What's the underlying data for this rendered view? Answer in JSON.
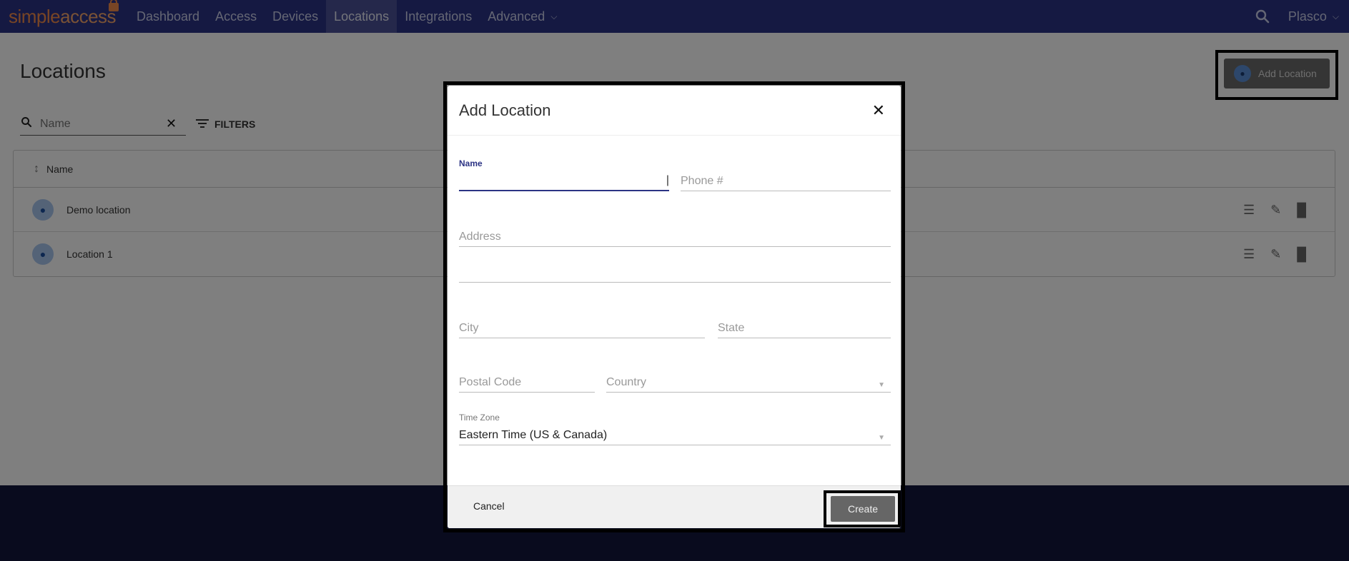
{
  "nav": {
    "logo_part1": "simple",
    "logo_part2": "access",
    "items": [
      {
        "label": "Dashboard"
      },
      {
        "label": "Access"
      },
      {
        "label": "Devices"
      },
      {
        "label": "Locations",
        "active": true
      },
      {
        "label": "Integrations"
      },
      {
        "label": "Advanced",
        "dropdown": true
      }
    ],
    "user": "Plasco"
  },
  "page": {
    "title": "Locations",
    "add_button": "Add Location",
    "search_placeholder": "Name",
    "filters_label": "FILTERS",
    "table": {
      "header_name": "Name",
      "rows": [
        {
          "name": "Demo location"
        },
        {
          "name": "Location 1"
        }
      ]
    }
  },
  "modal": {
    "title": "Add Location",
    "fields": {
      "name_label": "Name",
      "name_value": "",
      "phone_placeholder": "Phone #",
      "address_placeholder": "Address",
      "address2_placeholder": "",
      "city_placeholder": "City",
      "state_placeholder": "State",
      "postal_placeholder": "Postal Code",
      "country_placeholder": "Country",
      "timezone_label": "Time Zone",
      "timezone_value": "Eastern Time (US & Canada)"
    },
    "cancel_label": "Cancel",
    "create_label": "Create"
  },
  "colors": {
    "nav_bg": "#2b3384",
    "accent": "#2b3384",
    "logo_orange": "#f08a4b"
  }
}
